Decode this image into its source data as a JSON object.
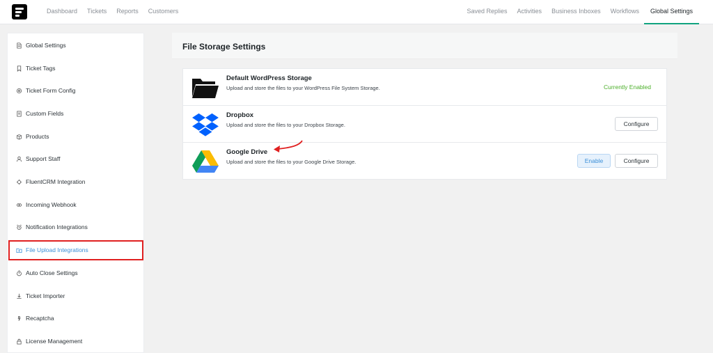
{
  "topnav": {
    "left_items": [
      "Dashboard",
      "Tickets",
      "Reports",
      "Customers"
    ],
    "right_items": [
      "Saved Replies",
      "Activities",
      "Business Inboxes",
      "Workflows",
      "Global Settings"
    ],
    "active": "Global Settings"
  },
  "sidebar": {
    "items": [
      {
        "label": "Global Settings",
        "icon": "document-icon"
      },
      {
        "label": "Ticket Tags",
        "icon": "bookmark-icon"
      },
      {
        "label": "Ticket Form Config",
        "icon": "gear-icon"
      },
      {
        "label": "Custom Fields",
        "icon": "document-icon"
      },
      {
        "label": "Products",
        "icon": "box-icon"
      },
      {
        "label": "Support Staff",
        "icon": "user-icon"
      },
      {
        "label": "FluentCRM Integration",
        "icon": "gear-icon"
      },
      {
        "label": "Incoming Webhook",
        "icon": "link-icon"
      },
      {
        "label": "Notification Integrations",
        "icon": "alarm-icon"
      },
      {
        "label": "File Upload Integrations",
        "icon": "folder-upload-icon"
      },
      {
        "label": "Auto Close Settings",
        "icon": "timer-icon"
      },
      {
        "label": "Ticket Importer",
        "icon": "download-icon"
      },
      {
        "label": "Recaptcha",
        "icon": "shield-icon"
      },
      {
        "label": "License Management",
        "icon": "lock-icon"
      }
    ],
    "active_index": 9
  },
  "main": {
    "title": "File Storage Settings",
    "providers": [
      {
        "name": "Default WordPress Storage",
        "description": "Upload and store the files to your WordPress File System Storage.",
        "icon": "folder-icon",
        "status": "Currently Enabled"
      },
      {
        "name": "Dropbox",
        "description": "Upload and store the files to your Dropbox Storage.",
        "icon": "dropbox-icon",
        "configure_label": "Configure"
      },
      {
        "name": "Google Drive",
        "description": "Upload and store the files to your Google Drive Storage.",
        "icon": "google-drive-icon",
        "enable_label": "Enable",
        "configure_label": "Configure"
      }
    ]
  },
  "colors": {
    "accent_green": "#10a37f",
    "enabled_status": "#4caf2a",
    "link_blue": "#3a8fd8",
    "highlight_red": "#e02020",
    "dropbox_blue": "#0061fe"
  }
}
